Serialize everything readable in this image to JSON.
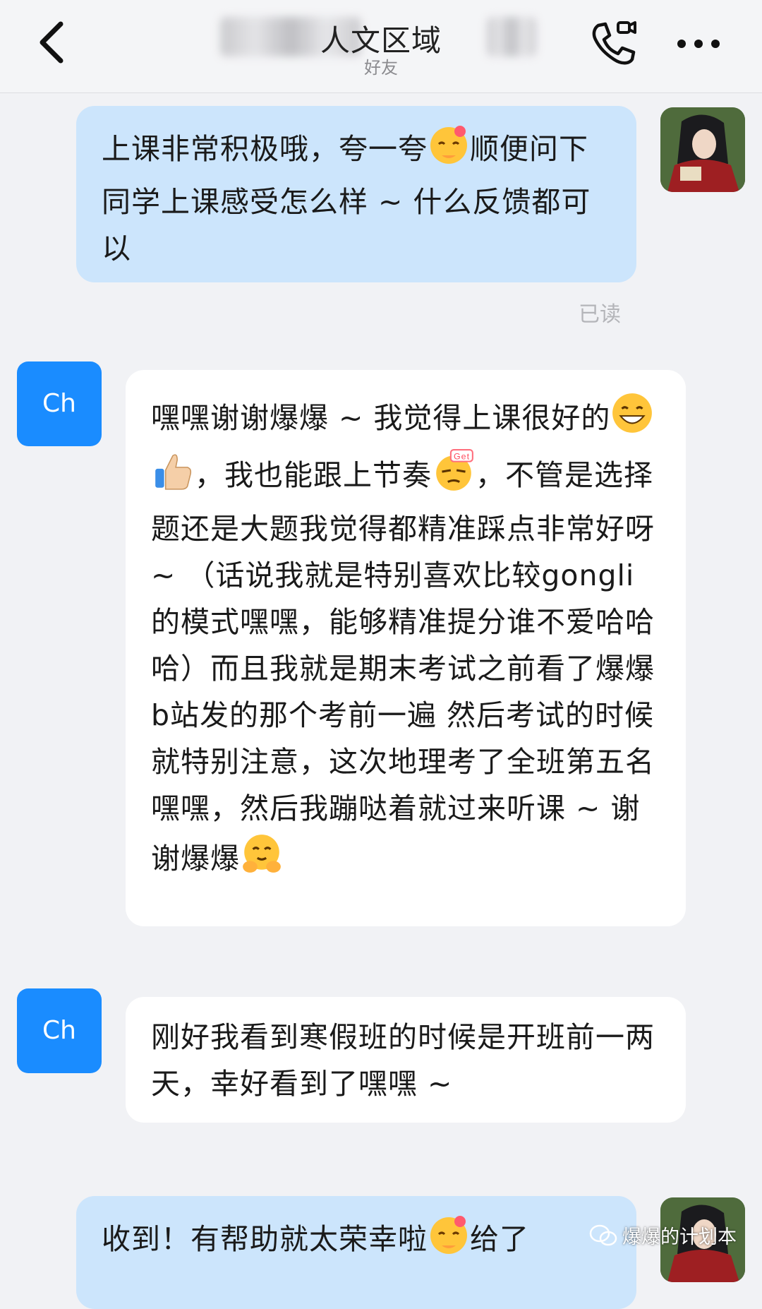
{
  "header": {
    "title": "人文区域",
    "subtitle": "好友",
    "back_icon": "chevron-left-icon",
    "call_icon": "phone-video-icon",
    "more_icon": "more-dots-icon"
  },
  "messages": [
    {
      "sender": "me",
      "text_a": "上课非常积极哦，夸一夸",
      "emoji_a": "shy-smile-emoji",
      "text_b": "顺便问下同学上课感受怎么样 ~ 什么反馈都可以"
    },
    {
      "read_receipt": "已读"
    },
    {
      "sender": "Ch",
      "avatar_label": "Ch",
      "text_a": "嘿嘿谢谢爆爆 ~ 我觉得上课很好的",
      "emoji_a": "grin-emoji",
      "emoji_b": "thumbs-up-emoji",
      "text_b": "，我也能跟上节奏",
      "emoji_c": "get-cool-emoji",
      "text_c": "，不管是选择题还是大题我觉得都精准踩点非常好呀 ~ （话说我就是特别喜欢比较gongli的模式嘿嘿，能够精准提分谁不爱哈哈哈）而且我就是期末考试之前看了爆爆b站发的那个考前一遍 然后考试的时候就特别注意，这次地理考了全班第五名嘿嘿，然后我蹦哒着就过来听课 ~ 谢谢爆爆",
      "emoji_d": "hug-emoji"
    },
    {
      "sender": "Ch",
      "avatar_label": "Ch",
      "text": "刚好我看到寒假班的时候是开班前一两天，幸好看到了嘿嘿 ~"
    },
    {
      "sender": "me",
      "text_a": "收到！有帮助就太荣幸啦",
      "emoji_a": "shy-smile-emoji",
      "text_b": "给了"
    }
  ],
  "watermark": "爆爆的计划本",
  "colors": {
    "my_bubble": "#cce5fc",
    "other_bubble": "#ffffff",
    "avatar_blue": "#1a8cff",
    "background": "#f1f2f5"
  }
}
